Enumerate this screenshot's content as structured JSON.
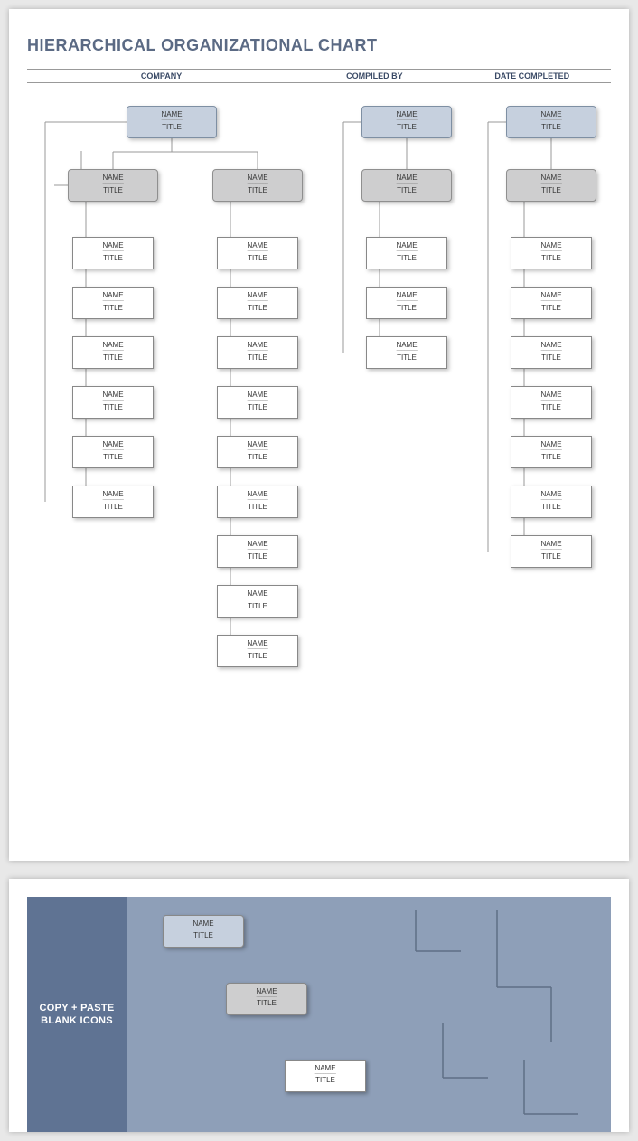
{
  "title": "HIERARCHICAL ORGANIZATIONAL CHART",
  "headers": {
    "company": "COMPANY",
    "compiled": "COMPILED BY",
    "date": "DATE COMPLETED"
  },
  "node": {
    "name": "NAME",
    "title": "TITLE",
    "sep": "––––––––"
  },
  "panelLabel": "COPY + PASTE BLANK ICONS",
  "chart_data": {
    "type": "tree",
    "description": "Blank hierarchical organization chart template. All nodes show placeholder NAME / TITLE.",
    "trees": [
      {
        "name": "NAME",
        "title": "TITLE",
        "style": "top",
        "children": [
          {
            "name": "NAME",
            "title": "TITLE",
            "style": "mgr",
            "children": [
              {
                "name": "NAME",
                "title": "TITLE"
              },
              {
                "name": "NAME",
                "title": "TITLE"
              },
              {
                "name": "NAME",
                "title": "TITLE"
              },
              {
                "name": "NAME",
                "title": "TITLE"
              },
              {
                "name": "NAME",
                "title": "TITLE"
              },
              {
                "name": "NAME",
                "title": "TITLE"
              }
            ]
          },
          {
            "name": "NAME",
            "title": "TITLE",
            "style": "mgr",
            "children": [
              {
                "name": "NAME",
                "title": "TITLE"
              },
              {
                "name": "NAME",
                "title": "TITLE"
              },
              {
                "name": "NAME",
                "title": "TITLE"
              },
              {
                "name": "NAME",
                "title": "TITLE"
              },
              {
                "name": "NAME",
                "title": "TITLE"
              },
              {
                "name": "NAME",
                "title": "TITLE"
              },
              {
                "name": "NAME",
                "title": "TITLE"
              },
              {
                "name": "NAME",
                "title": "TITLE"
              },
              {
                "name": "NAME",
                "title": "TITLE"
              }
            ]
          }
        ]
      },
      {
        "name": "NAME",
        "title": "TITLE",
        "style": "top",
        "children": [
          {
            "name": "NAME",
            "title": "TITLE",
            "style": "mgr",
            "children": [
              {
                "name": "NAME",
                "title": "TITLE"
              },
              {
                "name": "NAME",
                "title": "TITLE"
              },
              {
                "name": "NAME",
                "title": "TITLE"
              }
            ]
          }
        ]
      },
      {
        "name": "NAME",
        "title": "TITLE",
        "style": "top",
        "children": [
          {
            "name": "NAME",
            "title": "TITLE",
            "style": "mgr",
            "children": [
              {
                "name": "NAME",
                "title": "TITLE"
              },
              {
                "name": "NAME",
                "title": "TITLE"
              },
              {
                "name": "NAME",
                "title": "TITLE"
              },
              {
                "name": "NAME",
                "title": "TITLE"
              },
              {
                "name": "NAME",
                "title": "TITLE"
              },
              {
                "name": "NAME",
                "title": "TITLE"
              },
              {
                "name": "NAME",
                "title": "TITLE"
              }
            ]
          }
        ]
      }
    ],
    "palette": [
      {
        "name": "NAME",
        "title": "TITLE",
        "style": "top"
      },
      {
        "name": "NAME",
        "title": "TITLE",
        "style": "mgr"
      },
      {
        "name": "NAME",
        "title": "TITLE",
        "style": "leaf"
      }
    ]
  }
}
